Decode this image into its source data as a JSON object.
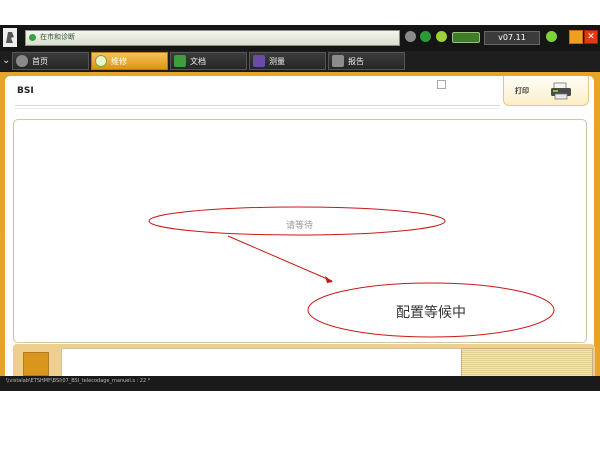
{
  "topbar": {
    "diag_field_text": "在市和诊断",
    "version": "v07.11"
  },
  "tabs": [
    {
      "label": "首页",
      "active": false,
      "icon": "home-icon"
    },
    {
      "label": "维修",
      "active": true,
      "icon": "magnifier-icon"
    },
    {
      "label": "文档",
      "active": false,
      "icon": "document-icon"
    },
    {
      "label": "测量",
      "active": false,
      "icon": "waveform-icon"
    },
    {
      "label": "报告",
      "active": false,
      "icon": "report-icon"
    }
  ],
  "panel": {
    "title": "BSI",
    "print_label": "打印"
  },
  "content": {
    "wait_text": "请等待",
    "callout_text": "配置等候中"
  },
  "status_bar": {
    "text": "\\\\vistalab\\ETSHMF\\BSI\\07_BSI_telecodage_manuel.s : 22 *"
  },
  "colors": {
    "accent_orange": "#e6a428",
    "annotation_red": "#c81818",
    "dark_chrome": "#1a1a1a"
  }
}
